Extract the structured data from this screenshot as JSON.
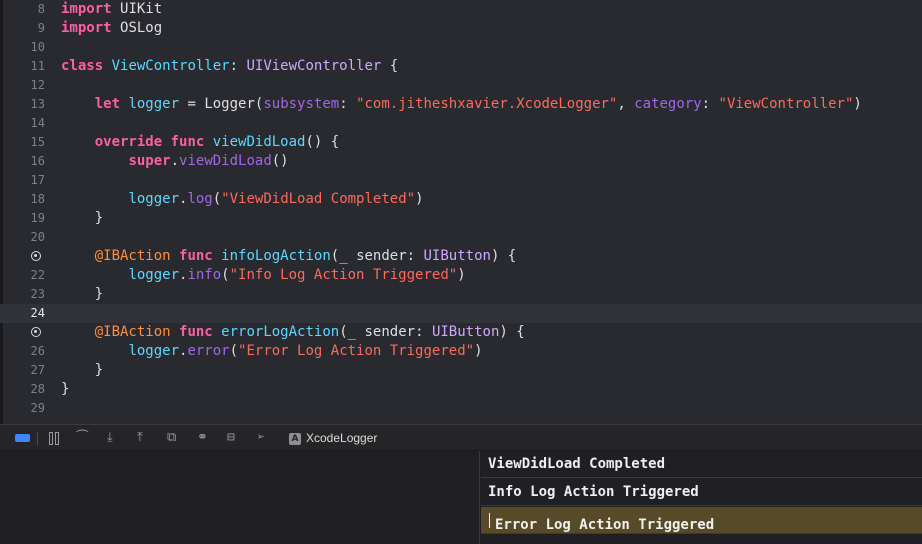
{
  "editor": {
    "lines": [
      {
        "n": "8"
      },
      {
        "n": "9"
      },
      {
        "n": "10"
      },
      {
        "n": "11"
      },
      {
        "n": "12"
      },
      {
        "n": "13"
      },
      {
        "n": "14"
      },
      {
        "n": "15"
      },
      {
        "n": "16"
      },
      {
        "n": "17"
      },
      {
        "n": "18"
      },
      {
        "n": "19"
      },
      {
        "n": "20"
      },
      {
        "n": "21"
      },
      {
        "n": "22"
      },
      {
        "n": "23"
      },
      {
        "n": "24"
      },
      {
        "n": "25"
      },
      {
        "n": "26"
      },
      {
        "n": "27"
      },
      {
        "n": "28"
      },
      {
        "n": "29"
      }
    ],
    "current_line": "24",
    "tokens": {
      "import": "import",
      "uikit": "UIKit",
      "oslog": "OSLog",
      "class": "class",
      "viewcontroller": "ViewController",
      "uiviewcontroller": "UIViewController",
      "let": "let",
      "logger": "logger",
      "logger_type": "Logger",
      "subsystem": "subsystem",
      "subsystem_value": "\"com.jitheshxavier.XcodeLogger\"",
      "category": "category",
      "category_value": "\"ViewController\"",
      "override": "override",
      "func": "func",
      "viewdidload": "viewDidLoad",
      "super": "super",
      "log": "log",
      "msg_completed": "\"ViewDidLoad Completed\"",
      "ibaction": "@IBAction",
      "infologaction": "infoLogAction",
      "errorlogaction": "errorLogAction",
      "underscore": "_",
      "sender": "sender",
      "uibutton": "UIButton",
      "info": "info",
      "error": "error",
      "msg_info": "\"Info Log Action Triggered\"",
      "msg_error": "\"Error Log Action Triggered\""
    }
  },
  "debug_bar": {
    "icons": [
      "console-toggle-icon",
      "pause-icon",
      "step-over-icon",
      "step-into-icon",
      "step-out-icon",
      "debug-view-hierarchy-icon",
      "memory-graph-icon",
      "environment-overrides-icon",
      "simulate-location-icon",
      "app-icon"
    ],
    "app_icon_glyph": "A",
    "app_name": "XcodeLogger"
  },
  "console": {
    "entries": [
      {
        "text": "ViewDidLoad Completed"
      },
      {
        "text": "Info Log Action Triggered"
      },
      {
        "text": "Error Log Action Triggered"
      }
    ],
    "selected_index": 2
  },
  "colors": {
    "editor_bg": "#292a30",
    "keyword": "#fc5fa3",
    "type": "#d0a8ff",
    "declaration": "#5dd8ff",
    "string": "#fc6a5d",
    "method": "#a167e6",
    "attribute": "#fd8f3f",
    "selection": "#574a29",
    "accent": "#3d86f7"
  }
}
